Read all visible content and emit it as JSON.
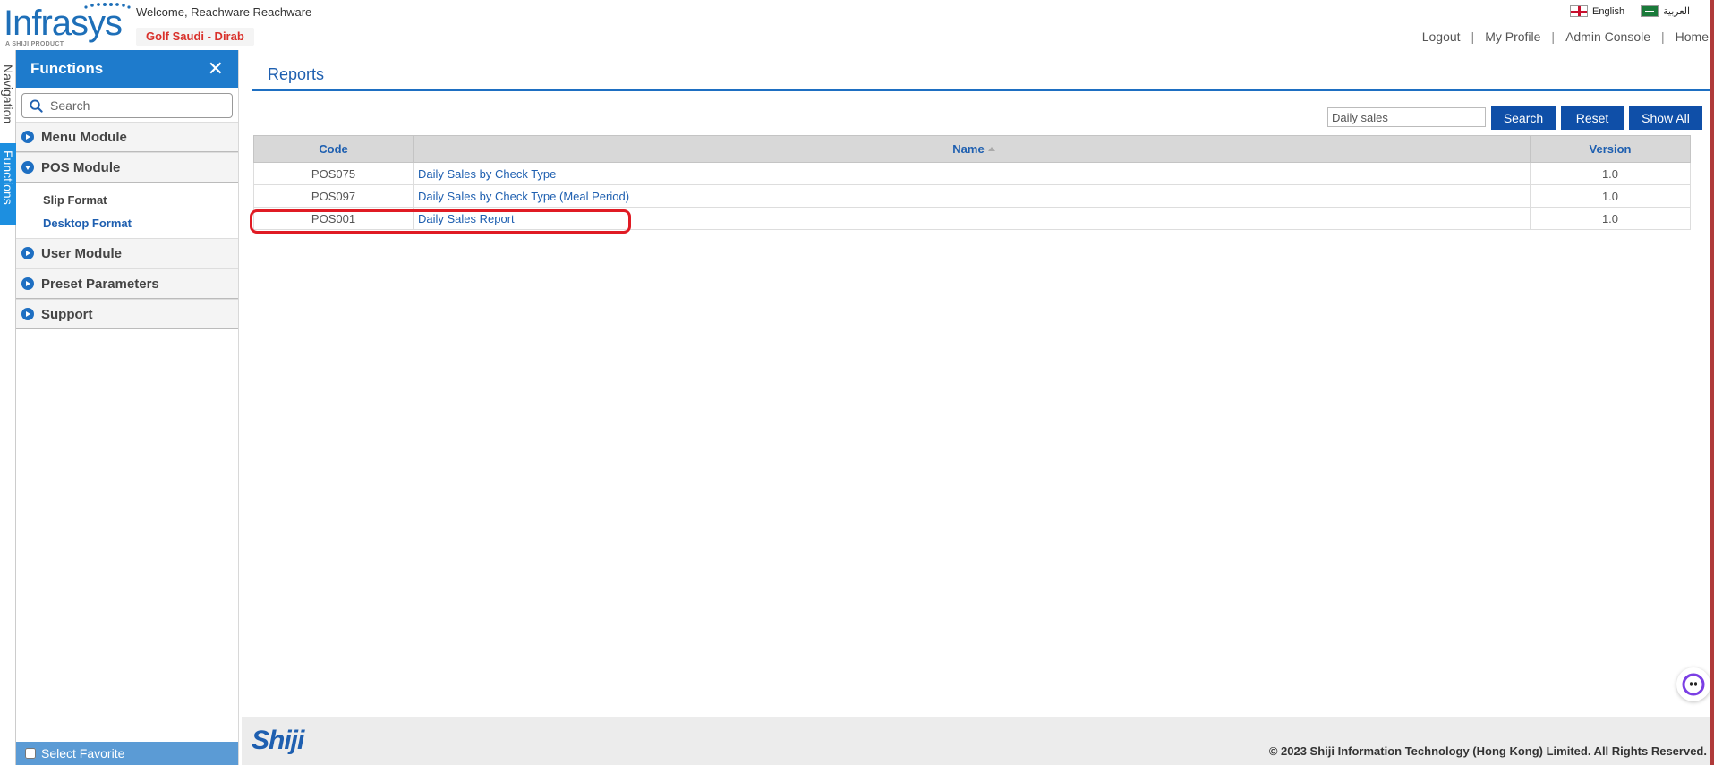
{
  "header": {
    "logo_text": "Infrasys",
    "logo_subtitle": "A SHIJI PRODUCT",
    "welcome": "Welcome, Reachware Reachware",
    "property": "Golf Saudi - Dirab",
    "languages": [
      {
        "label": "English",
        "flag": "flag-uk-icon"
      },
      {
        "label": "العربية",
        "flag": "flag-saudi-icon"
      }
    ],
    "nav": {
      "logout": "Logout",
      "my_profile": "My Profile",
      "admin_console": "Admin Console",
      "home": "Home",
      "separator": "|"
    }
  },
  "vertical_tabs": {
    "navigation": "Navigation",
    "functions": "Functions"
  },
  "sidebar": {
    "title": "Functions",
    "search_placeholder": "Search",
    "modules": [
      {
        "label": "Menu Module",
        "expanded": false
      },
      {
        "label": "POS Module",
        "expanded": true,
        "items": [
          {
            "label": "Slip Format",
            "active": false
          },
          {
            "label": "Desktop Format",
            "active": true
          }
        ]
      },
      {
        "label": "User Module",
        "expanded": false
      },
      {
        "label": "Preset Parameters",
        "expanded": false
      },
      {
        "label": "Support",
        "expanded": false
      }
    ],
    "select_favorite": "Select Favorite"
  },
  "main": {
    "title": "Reports",
    "search_value": "Daily sales",
    "buttons": {
      "search": "Search",
      "reset": "Reset",
      "show_all": "Show All"
    },
    "table": {
      "columns": [
        "Code",
        "Name",
        "Version"
      ],
      "rows": [
        {
          "code": "POS075",
          "name": "Daily Sales by Check Type",
          "version": "1.0"
        },
        {
          "code": "POS097",
          "name": "Daily Sales by Check Type (Meal Period)",
          "version": "1.0"
        },
        {
          "code": "POS001",
          "name": "Daily Sales Report",
          "version": "1.0"
        }
      ]
    }
  },
  "footer": {
    "brand": "Shiji",
    "copyright": "© 2023 Shiji Information Technology (Hong Kong) Limited. All Rights Reserved."
  },
  "colors": {
    "primary_blue": "#1e7bcc",
    "button_blue": "#0f4fa8",
    "link_blue": "#1e5fb0",
    "highlight_red": "#e01b24",
    "property_red": "#d9302a"
  }
}
